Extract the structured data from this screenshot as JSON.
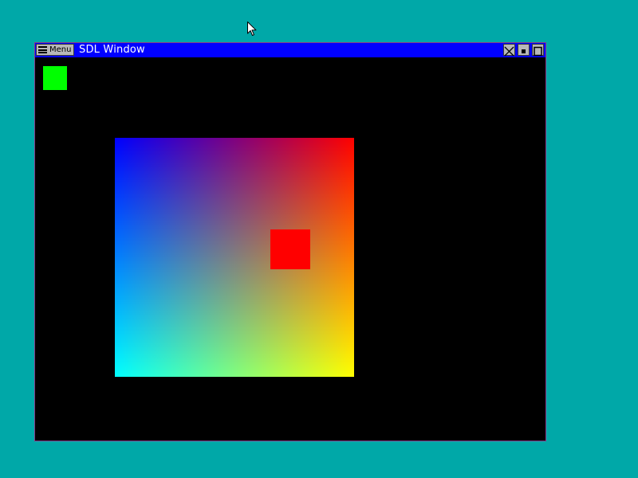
{
  "desktop": {
    "background_color": "#00a8a8"
  },
  "cursor": {
    "icon": "arrow-cursor-icon"
  },
  "window": {
    "title": "SDL Window",
    "titlebar_color": "#0000ff",
    "menu_button": {
      "label": "Menu",
      "icon": "hamburger-icon"
    },
    "controls": {
      "close_icon": "close-icon",
      "minimize_icon": "minimize-icon",
      "maximize_icon": "maximize-icon"
    }
  },
  "canvas": {
    "background_color": "#000000",
    "green_square_color": "#00ff00",
    "red_square_color": "#ff0000",
    "gradient_corners": {
      "top_left": "#0000ff",
      "top_right": "#ff0000",
      "bottom_left": "#00ffff",
      "bottom_right": "#ffff00"
    }
  }
}
